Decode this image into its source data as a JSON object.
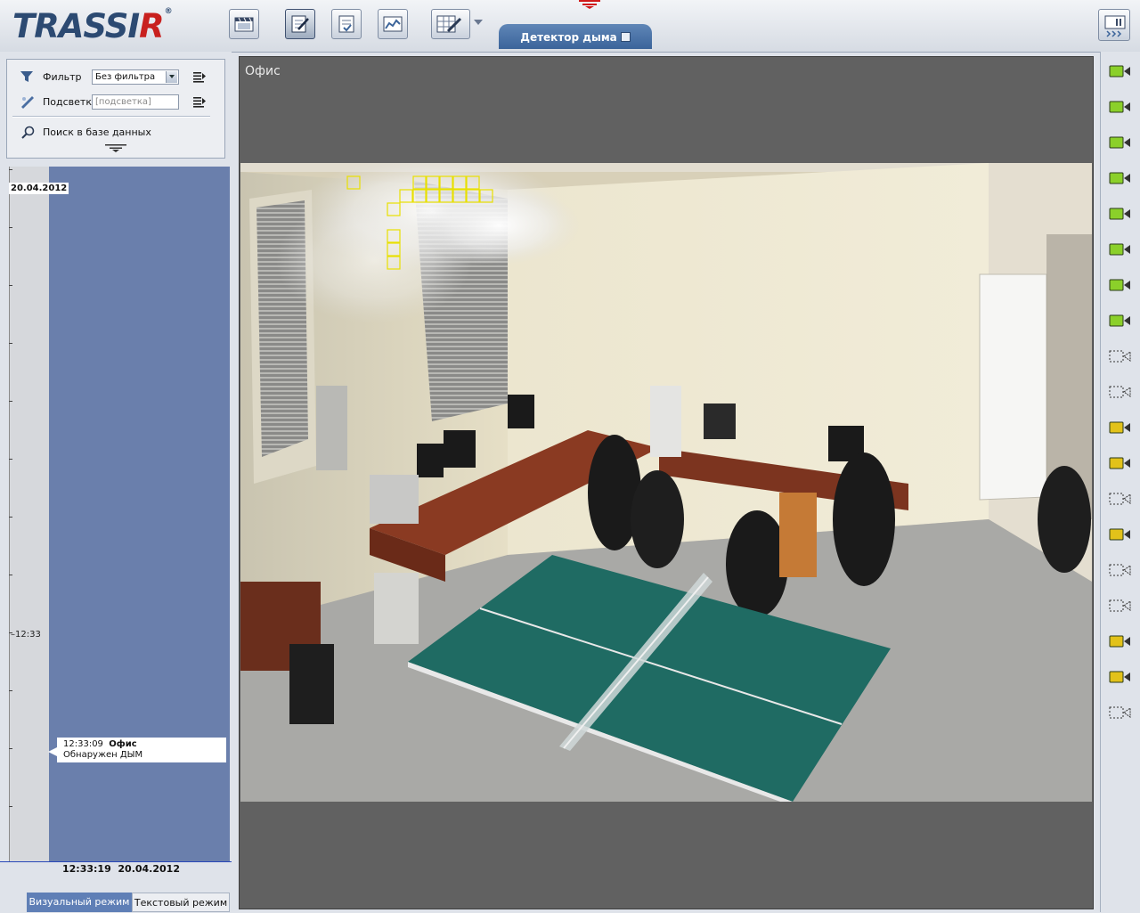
{
  "app": {
    "logo": {
      "main": "TRASSI",
      "r": "R",
      "reg": "®"
    },
    "active_tab": "Детектор дыма"
  },
  "filters": {
    "filter_label": "Фильтр",
    "filter_value": "Без фильтра",
    "highlight_label": "Подсветка",
    "highlight_placeholder": "[подсветка]",
    "search_db_label": "Поиск в базе данных"
  },
  "timeline": {
    "date_top": "20.04.2012",
    "time_mark": "12:33",
    "event": {
      "time": "12:33:09",
      "camera": "Офис",
      "text": "Обнаружен ДЫМ"
    },
    "current": "12:33:19  20.04.2012"
  },
  "modes": {
    "visual": "Визуальный режим",
    "text": "Текстовый режим"
  },
  "viewer": {
    "camera_name": "Офис"
  },
  "cameras": [
    {
      "status": "active"
    },
    {
      "status": "active"
    },
    {
      "status": "active"
    },
    {
      "status": "active"
    },
    {
      "status": "active"
    },
    {
      "status": "active"
    },
    {
      "status": "active"
    },
    {
      "status": "active"
    },
    {
      "status": "offline"
    },
    {
      "status": "offline"
    },
    {
      "status": "yellow"
    },
    {
      "status": "yellow"
    },
    {
      "status": "offline"
    },
    {
      "status": "yellow"
    },
    {
      "status": "offline"
    },
    {
      "status": "offline"
    },
    {
      "status": "yellow"
    },
    {
      "status": "yellow"
    },
    {
      "status": "offline"
    }
  ],
  "colors": {
    "accent": "#3b649a",
    "timeline_blue": "#6a7fac",
    "camera_active": "#8bd02a",
    "camera_yellow": "#e2c21a",
    "detection": "#e8e000"
  }
}
